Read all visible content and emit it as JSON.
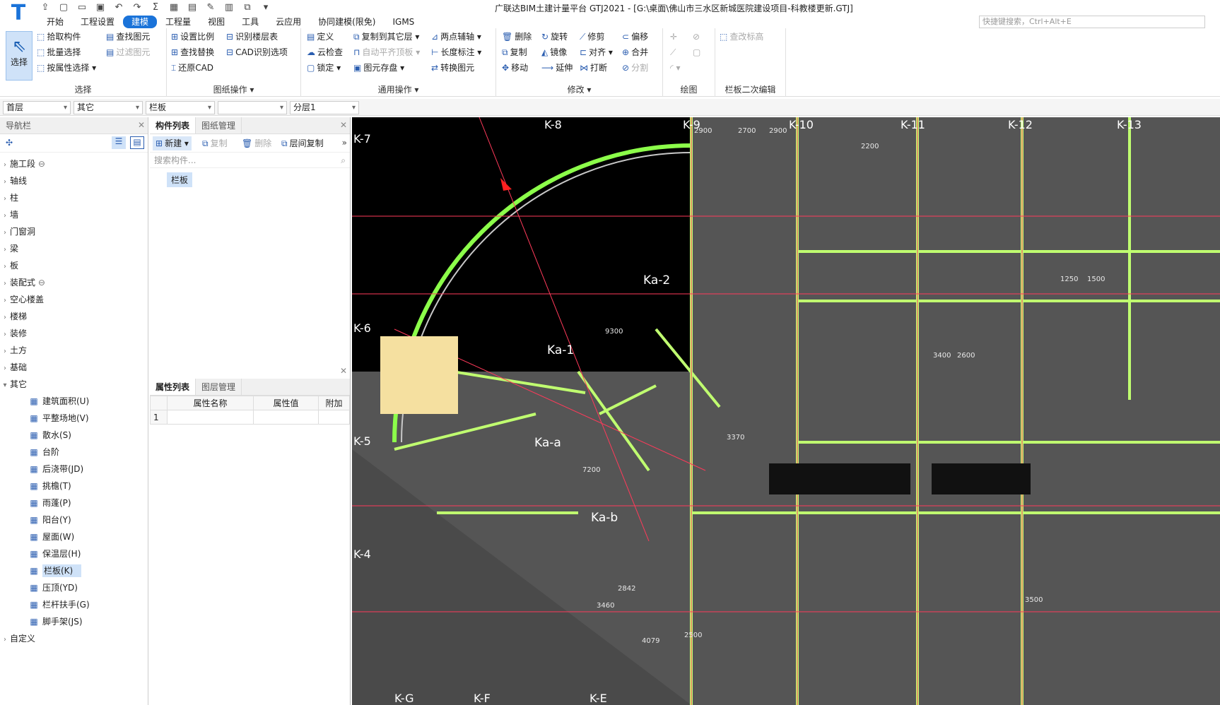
{
  "app": {
    "window_title": "广联达BIM土建计量平台 GTJ2021 - [G:\\桌面\\佛山市三水区新城医院建设项目-科教楼更新.GTJ]",
    "search_placeholder": "快捷键搜索，Ctrl+Alt+E"
  },
  "menu": [
    "开始",
    "工程设置",
    "建模",
    "工程量",
    "视图",
    "工具",
    "云应用",
    "协同建模(限免)",
    "IGMS"
  ],
  "menu_active": "建模",
  "ribbon": {
    "select": {
      "big": "选择",
      "items": [
        "拾取构件",
        "批量选择",
        "按属性选择",
        "查找图元",
        "过滤图元"
      ],
      "label": "选择"
    },
    "drawing": {
      "items": [
        "设置比例",
        "查找替换",
        "还原CAD",
        "识别楼层表",
        "CAD识别选项"
      ],
      "label": "图纸操作"
    },
    "common": {
      "items": [
        "定义",
        "云检查",
        "锁定",
        "复制到其它层",
        "自动平齐顶板",
        "图元存盘",
        "两点辅轴",
        "长度标注",
        "转换图元"
      ],
      "label": "通用操作"
    },
    "modify": {
      "items": [
        "删除",
        "旋转",
        "修剪",
        "偏移",
        "复制",
        "镜像",
        "对齐",
        "合并",
        "移动",
        "延伸",
        "打断",
        "分割"
      ],
      "label": "修改"
    },
    "draw": {
      "label": "绘图"
    },
    "railing": {
      "items": [
        "查改标高"
      ],
      "label": "栏板二次编辑"
    }
  },
  "filters": [
    "首层",
    "其它",
    "栏板",
    "",
    "分层1"
  ],
  "nav": {
    "title": "导航栏",
    "tree": [
      {
        "label": "施工段",
        "lock": true
      },
      {
        "label": "轴线"
      },
      {
        "label": "柱"
      },
      {
        "label": "墙"
      },
      {
        "label": "门窗洞"
      },
      {
        "label": "梁"
      },
      {
        "label": "板"
      },
      {
        "label": "装配式",
        "lock": true
      },
      {
        "label": "空心楼盖"
      },
      {
        "label": "楼梯"
      },
      {
        "label": "装修"
      },
      {
        "label": "土方"
      },
      {
        "label": "基础"
      },
      {
        "label": "其它",
        "open": true
      }
    ],
    "children": [
      "建筑面积(U)",
      "平整场地(V)",
      "散水(S)",
      "台阶",
      "后浇带(JD)",
      "挑檐(T)",
      "雨蓬(P)",
      "阳台(Y)",
      "屋面(W)",
      "保温层(H)",
      "栏板(K)",
      "压顶(YD)",
      "栏杆扶手(G)",
      "脚手架(JS)"
    ],
    "selected_child": "栏板(K)",
    "last": "自定义"
  },
  "components": {
    "tabs": [
      "构件列表",
      "图纸管理"
    ],
    "toolbar": [
      "新建",
      "复制",
      "删除",
      "层间复制"
    ],
    "search_placeholder": "搜索构件...",
    "items": [
      "栏板"
    ]
  },
  "properties": {
    "tabs": [
      "属性列表",
      "图层管理"
    ],
    "columns": [
      "属性名称",
      "属性值",
      "附加"
    ],
    "rows": [
      [
        "1",
        "",
        ""
      ]
    ]
  },
  "cad": {
    "axis_labels": [
      "K-8",
      "K-9",
      "K-10",
      "K-11",
      "K-12",
      "K-13",
      "K-7",
      "K-6",
      "K-5",
      "K-4",
      "K-G",
      "K-F",
      "K-E"
    ],
    "zone_labels": [
      "Ka-1",
      "Ka-2",
      "Ka-a",
      "Ka-b"
    ],
    "dims": [
      "9300",
      "7200",
      "2900",
      "2700",
      "2900",
      "2200",
      "3400",
      "2600",
      "3500",
      "1500",
      "1250",
      "2842",
      "3460",
      "4079",
      "2500",
      "3370"
    ]
  }
}
